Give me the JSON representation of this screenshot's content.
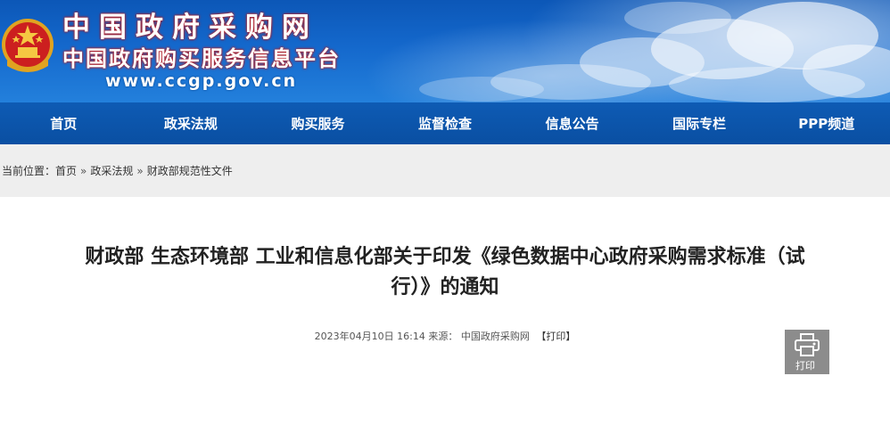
{
  "header": {
    "title_cn": "中国政府采购网",
    "subtitle_cn": "中国政府购买服务信息平台",
    "url": "www.ccgp.gov.cn",
    "emblem_icon": "national-emblem-icon",
    "colors": {
      "banner": "#1468cc",
      "title_outline": "#c21a1a"
    }
  },
  "nav": {
    "items": [
      {
        "label": "首页"
      },
      {
        "label": "政采法规"
      },
      {
        "label": "购买服务"
      },
      {
        "label": "监督检查"
      },
      {
        "label": "信息公告"
      },
      {
        "label": "国际专栏"
      },
      {
        "label": "PPP频道"
      }
    ],
    "color": "#0a4fa2"
  },
  "breadcrumb": {
    "prefix": "当前位置：",
    "items": [
      "首页",
      "政采法规",
      "财政部规范性文件"
    ],
    "separator": "»"
  },
  "article": {
    "title_line1": "财政部 生态环境部 工业和信息化部关于印发《绿色数据中心政府采购需求标准（试",
    "title_line2": "行）》的通知",
    "datetime": "2023年04月10日 16:14",
    "source_label": "来源：",
    "source": "中国政府采购网",
    "print_link": "【打印】"
  },
  "print_button": {
    "label": "打印",
    "icon": "printer-icon",
    "color": "#8c8c8c"
  }
}
